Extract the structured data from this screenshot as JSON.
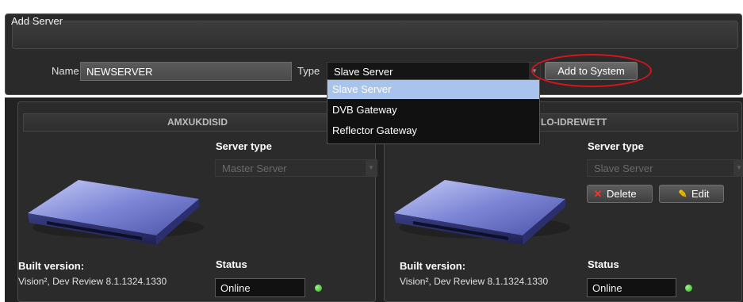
{
  "add_server": {
    "title": "Add Server",
    "name_label": "Name",
    "name_value": "NEWSERVER",
    "type_label": "Type",
    "type_value": "Slave Server",
    "add_button": "Add to System",
    "dropdown_options": [
      "Slave Server",
      "DVB Gateway",
      "Reflector Gateway"
    ]
  },
  "servers": [
    {
      "name": "AMXUKDISID",
      "server_type_label": "Server type",
      "server_type": "Master Server",
      "built_label": "Built version:",
      "built_version": "Vision², Dev Review 8.1.1324.1330",
      "status_label": "Status",
      "status": "Online"
    },
    {
      "name": "LO-IDREWETT",
      "server_type_label": "Server type",
      "server_type": "Slave Server",
      "delete_button": "Delete",
      "edit_button": "Edit",
      "built_label": "Built version:",
      "built_version": "Vision², Dev Review 8.1.1324.1330",
      "status_label": "Status",
      "status": "Online"
    }
  ],
  "colors": {
    "highlight": "#d9141c",
    "selected_option": "#a9c4ec",
    "status_online": "#2bb01a"
  },
  "icons": [
    "server-drive-icon",
    "delete-x-icon",
    "edit-pencil-icon",
    "chevron-down-icon"
  ]
}
